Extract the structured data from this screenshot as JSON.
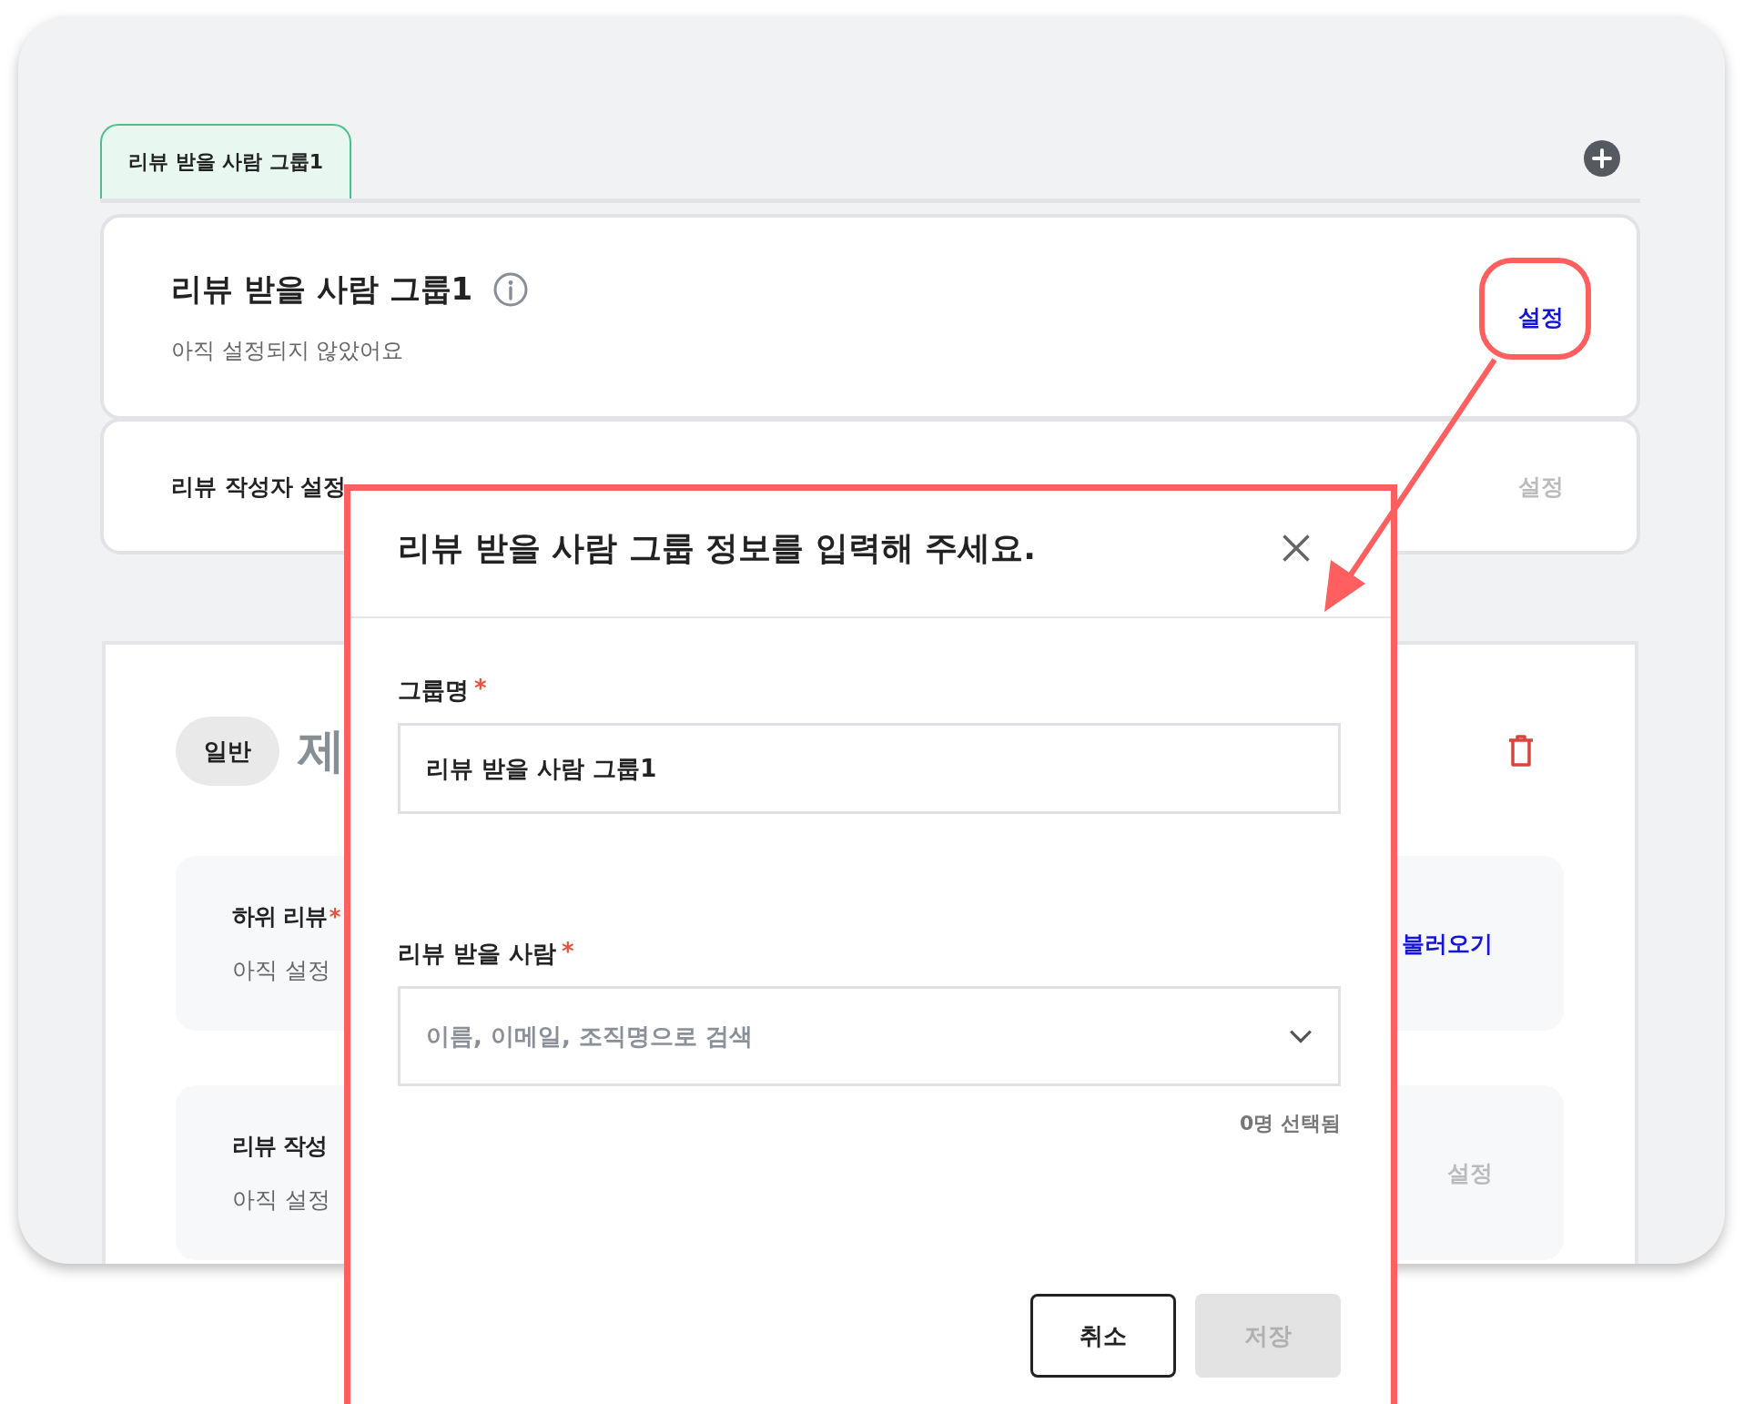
{
  "tabs": [
    {
      "label": "리뷰 받을 사람 그룹1",
      "selected": true
    }
  ],
  "group_card": {
    "title": "리뷰 받을 사람 그룹1",
    "subtitle": "아직 설정되지 않았어요",
    "action": "설정",
    "action_enabled": true
  },
  "writer_card": {
    "title": "리뷰 작성자 설정",
    "action": "설정",
    "action_enabled": false
  },
  "section": {
    "badge": "일반",
    "title": "제",
    "items": [
      {
        "title": "하위 리뷰",
        "required_mark": "*",
        "subtitle": "아직 설정",
        "action": "불러오기",
        "action_enabled": true
      },
      {
        "title": "리뷰 작성",
        "subtitle": "아직 설정",
        "action": "설정",
        "action_enabled": false
      }
    ]
  },
  "dialog": {
    "title": "리뷰 받을 사람 그룹 정보를 입력해 주세요.",
    "fields": [
      {
        "kind": "text",
        "label": "그룹명",
        "required_mark": "*",
        "value": "리뷰 받을 사람 그룹1"
      },
      {
        "kind": "select",
        "label": "리뷰 받을 사람",
        "required_mark": "*",
        "placeholder": "이름, 이메일, 조직명으로 검색"
      }
    ],
    "selection_count": "0명 선택됨",
    "buttons": [
      {
        "label": "취소",
        "kind": "outline",
        "disabled": false
      },
      {
        "label": "저장",
        "kind": "primary",
        "disabled": true
      }
    ]
  }
}
